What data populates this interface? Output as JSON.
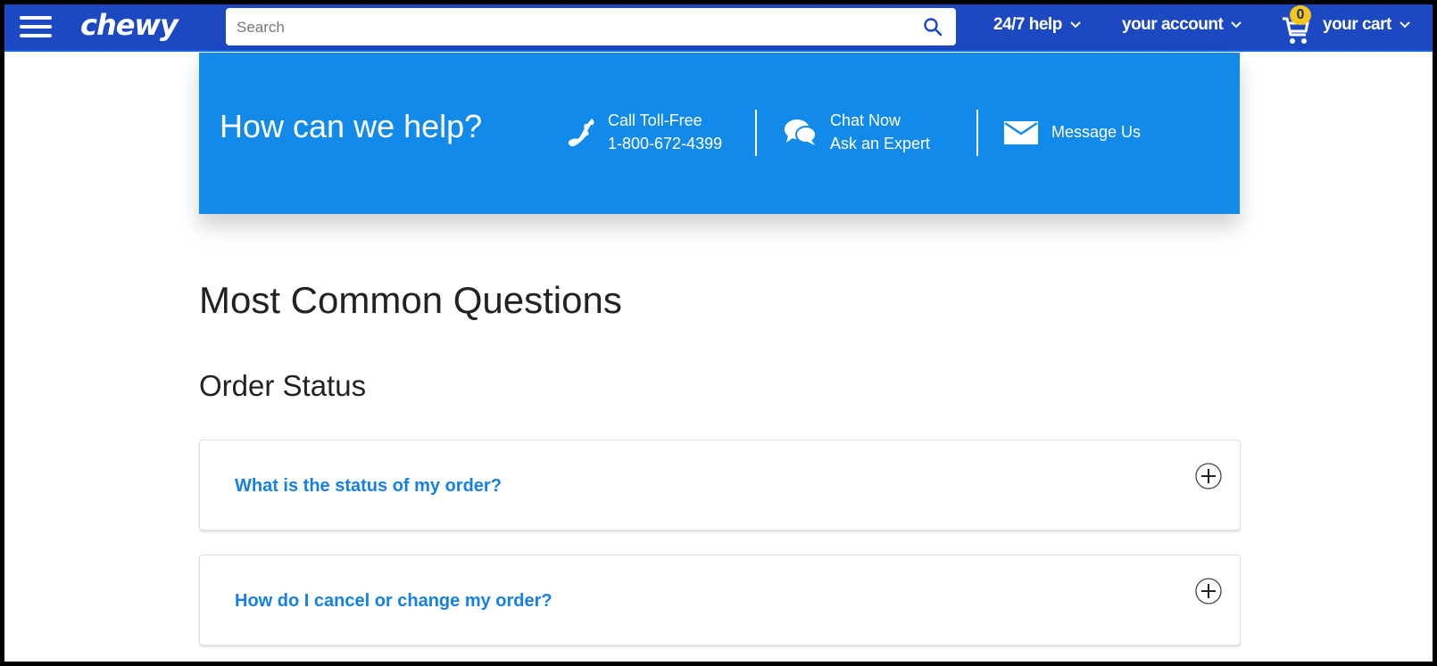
{
  "header": {
    "brand": "chewy",
    "search": {
      "placeholder": "Search",
      "value": ""
    },
    "nav": [
      {
        "label": "24/7 help",
        "icon": "chevron-down-icon"
      },
      {
        "label": "your account",
        "icon": "chevron-down-icon"
      },
      {
        "label": "your cart",
        "icon": "chevron-down-icon"
      }
    ],
    "cart_count": "0"
  },
  "help_banner": {
    "title": "How can we help?",
    "contacts": [
      {
        "icon": "phone-icon",
        "line1": "Call Toll-Free",
        "line2": "1-800-672-4399"
      },
      {
        "icon": "chat-icon",
        "line1": "Chat Now",
        "line2": "Ask an Expert"
      },
      {
        "icon": "envelope-icon",
        "line1": "Message Us",
        "line2": ""
      }
    ],
    "colors": {
      "background": "#128ae9"
    }
  },
  "main": {
    "title": "Most Common Questions",
    "section": "Order Status",
    "faqs": [
      {
        "question": "What is the status of my order?"
      },
      {
        "question": "How do I cancel or change my order?"
      }
    ]
  },
  "colors": {
    "nav_bar": "#1c49c2",
    "link": "#1480e6",
    "badge": "#f5c518"
  }
}
